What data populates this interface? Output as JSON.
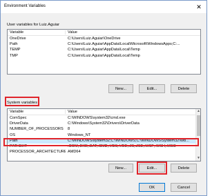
{
  "window": {
    "title": "Environment Variables",
    "close_glyph": "✕"
  },
  "user_section": {
    "label": "User variables for Luiz.Aguiar",
    "headers": {
      "variable": "Variable",
      "value": "Value"
    },
    "rows": [
      {
        "variable": "OneDrive",
        "value": "C:\\Users\\Luiz.Aguiar\\OneDrive"
      },
      {
        "variable": "Path",
        "value": "C:\\Users\\Luiz.Aguiar\\AppData\\Local\\Microsoft\\WindowsApps;C:..."
      },
      {
        "variable": "TEMP",
        "value": "C:\\Users\\Luiz.Aguiar\\AppData\\Local\\Temp"
      },
      {
        "variable": "TMP",
        "value": "C:\\Users\\Luiz.Aguiar\\AppData\\Local\\Temp"
      }
    ],
    "buttons": {
      "new": "New...",
      "edit": "Edit...",
      "delete": "Delete"
    }
  },
  "system_section": {
    "label": "System variables",
    "headers": {
      "variable": "Variable",
      "value": "Value"
    },
    "rows": [
      {
        "variable": "ComSpec",
        "value": "C:\\WINDOWS\\system32\\cmd.exe"
      },
      {
        "variable": "DriverData",
        "value": "C:\\Windows\\System32\\Drivers\\DriverData"
      },
      {
        "variable": "NUMBER_OF_PROCESSORS",
        "value": "8"
      },
      {
        "variable": "OS",
        "value": "Windows_NT"
      },
      {
        "variable": "Path",
        "value": "C:\\WINDOWS\\system32;C:\\WINDOWS;C:\\WINDOWS\\System32\\Wb..."
      },
      {
        "variable": "PATHEXT",
        "value": ".COM;.EXE;.BAT;.CMD;.VBS;.VBE;.JS;.JSE;.WSF;.WSH;.MSC"
      },
      {
        "variable": "PROCESSOR_ARCHITECTURE",
        "value": "AMD64"
      }
    ],
    "buttons": {
      "new": "New...",
      "edit": "Edit...",
      "delete": "Delete"
    }
  },
  "footer": {
    "ok": "OK",
    "cancel": "Cancel"
  },
  "colors": {
    "highlight": "#e0232a",
    "selection": "#cce8ff"
  }
}
